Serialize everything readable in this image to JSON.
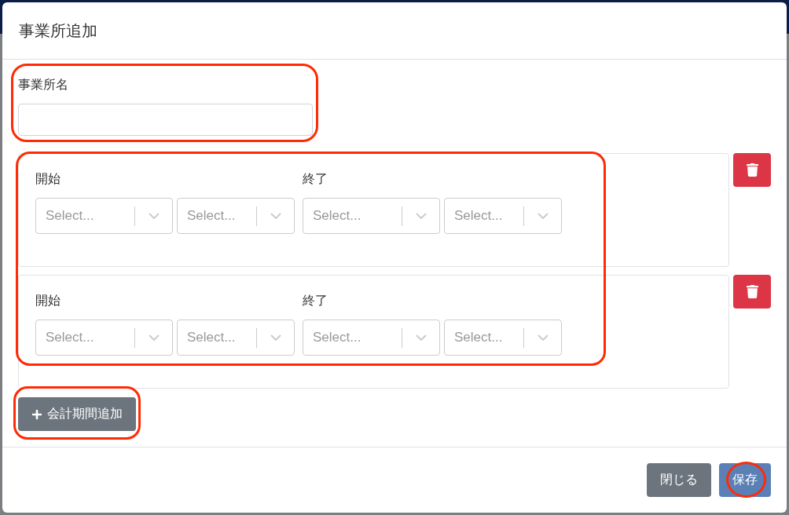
{
  "dialog": {
    "title": "事業所追加"
  },
  "office_name": {
    "label": "事業所名",
    "highlighted": true
  },
  "periods": {
    "highlighted": true,
    "items": [
      {
        "start": {
          "label": "開始",
          "selects": [
            {
              "placeholder": "Select..."
            },
            {
              "placeholder": "Select..."
            }
          ]
        },
        "end": {
          "label": "終了",
          "selects": [
            {
              "placeholder": "Select..."
            },
            {
              "placeholder": "Select..."
            }
          ]
        }
      },
      {
        "start": {
          "label": "開始",
          "selects": [
            {
              "placeholder": "Select..."
            },
            {
              "placeholder": "Select..."
            }
          ]
        },
        "end": {
          "label": "終了",
          "selects": [
            {
              "placeholder": "Select..."
            },
            {
              "placeholder": "Select..."
            }
          ]
        }
      }
    ]
  },
  "add_period_button": {
    "label": "会計期間追加",
    "highlighted": true
  },
  "footer": {
    "buttons": [
      {
        "label": "閉じる",
        "kind": "secondary",
        "highlighted": false
      },
      {
        "label": "保存",
        "kind": "primary",
        "highlighted": true
      }
    ]
  }
}
